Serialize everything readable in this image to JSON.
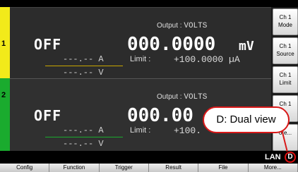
{
  "channels": [
    {
      "number": "1",
      "output_label": "Output :",
      "output_mode": "VOLTS",
      "state": "OFF",
      "main_value": "000.0000",
      "main_unit": "mV",
      "current_readout": "---.-- A",
      "voltage_readout": "---.-- V",
      "limit_label": "Limit :",
      "limit_value": "+100.0000 µA",
      "stripe_color": "#f2ea1a"
    },
    {
      "number": "2",
      "output_label": "Output :",
      "output_mode": "VOLTS",
      "state": "OFF",
      "main_value": "000.00",
      "main_unit": "",
      "current_readout": "---.-- A",
      "voltage_readout": "---.-- V",
      "limit_label": "Limit :",
      "limit_value": "+100.",
      "stripe_color": "#1aab2e"
    }
  ],
  "sidebar": {
    "buttons": [
      {
        "line1": "Ch 1",
        "line2": "Mode"
      },
      {
        "line1": "Ch 1",
        "line2": "Source"
      },
      {
        "line1": "Ch 1",
        "line2": "Limit"
      },
      {
        "line1": "Ch 1",
        "line2": ""
      },
      {
        "line1": "",
        "line2": "ore..."
      }
    ]
  },
  "status_bar": {
    "lan": "LAN",
    "view_indicator": "D"
  },
  "softkeys": [
    "Config",
    "Function",
    "Trigger",
    "Result",
    "File",
    "More..."
  ],
  "callout": {
    "text": "D: Dual view",
    "color": "#d81818"
  }
}
